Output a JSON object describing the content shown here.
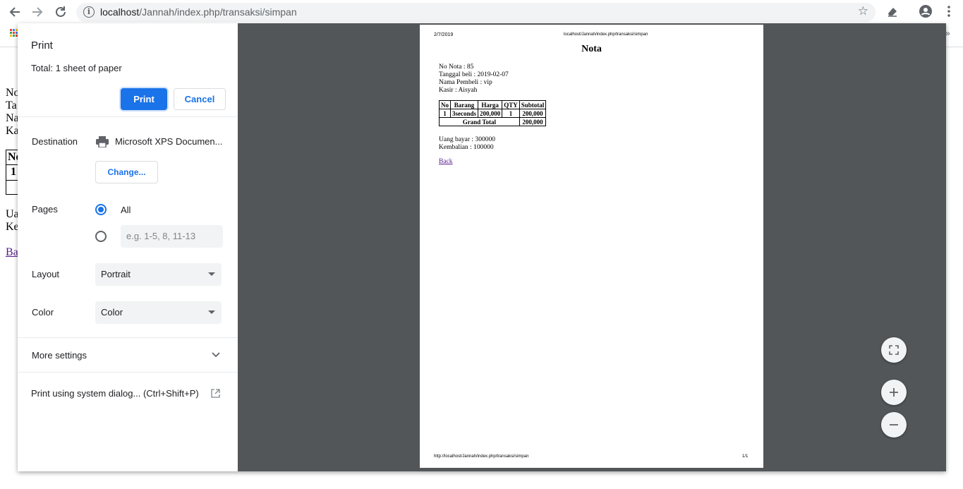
{
  "browser": {
    "url_host": "localhost",
    "url_path": "/Jannah/index.php/transaksi/simpan"
  },
  "background_page": {
    "lines": [
      "No",
      "Ta",
      "Na",
      "Ka"
    ],
    "table_cell": "1",
    "lines2": [
      "Ua",
      "Ke"
    ],
    "link": "Ba"
  },
  "print_dialog": {
    "title": "Print",
    "total_label": "Total:",
    "total_value": "1 sheet of paper",
    "print_button": "Print",
    "cancel_button": "Cancel",
    "destination_label": "Destination",
    "destination_value": "Microsoft XPS Documen...",
    "change_button": "Change...",
    "pages_label": "Pages",
    "pages_all": "All",
    "pages_placeholder": "e.g. 1-5, 8, 11-13",
    "layout_label": "Layout",
    "layout_value": "Portrait",
    "color_label": "Color",
    "color_value": "Color",
    "more_settings": "More settings",
    "system_dialog": "Print using system dialog... (Ctrl+Shift+P)"
  },
  "preview": {
    "header_date": "2/7/2019",
    "header_url": "localhost/Jannah/index.php/transaksi/simpan",
    "title": "Nota",
    "info": {
      "no_nota": "No Nota : 85",
      "tanggal": "Tanggal beli : 2019-02-07",
      "pembeli": "Nama Pembeli : vip",
      "kasir": "Kasir : Aisyah"
    },
    "table": {
      "headers": [
        "No",
        "Barang",
        "Harga",
        "QTY",
        "Subtotal"
      ],
      "row": [
        "1",
        "3seconds",
        "200,000",
        "1",
        "200,000"
      ],
      "grand_total_label": "Grand Total",
      "grand_total_value": "200,000"
    },
    "payment": {
      "bayar": "Uang bayar : 300000",
      "kembalian": "Kembalian : 100000"
    },
    "back_link": "Back",
    "footer_url": "http://localhost/Jannah/index.php/transaksi/simpan",
    "footer_page": "1/1"
  },
  "colors": {
    "accent": "#1a73e8",
    "preview_bg": "#525659"
  }
}
